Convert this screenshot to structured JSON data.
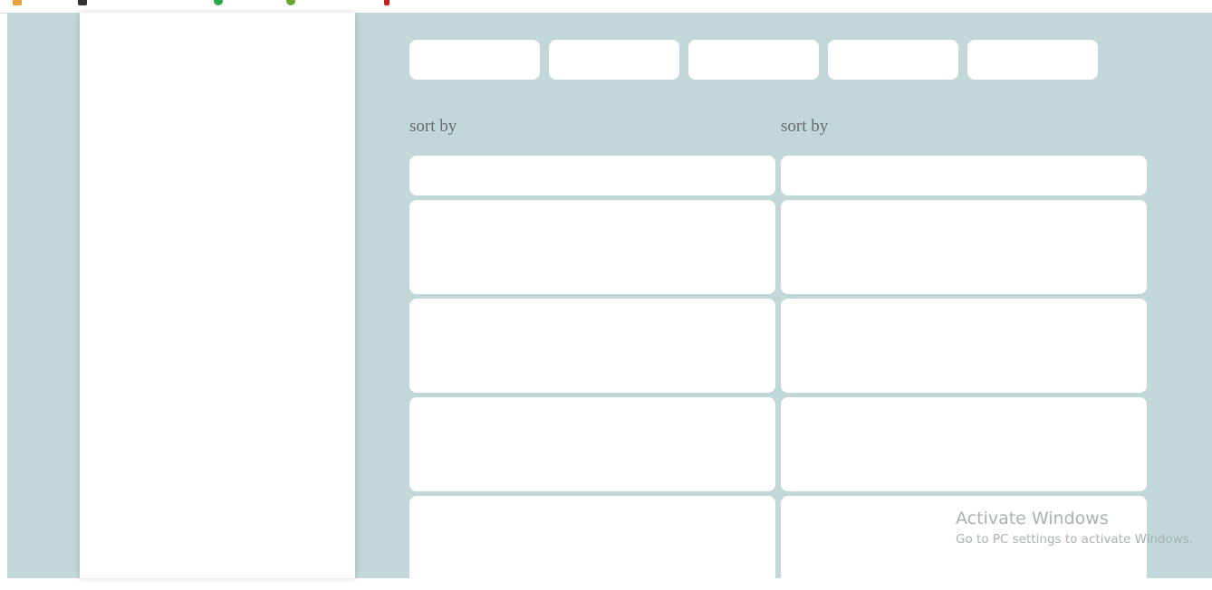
{
  "sort": {
    "left_label": "sort by",
    "right_label": "sort by"
  },
  "filters": [
    "",
    "",
    "",
    "",
    ""
  ],
  "watermark": {
    "title": "Activate Windows",
    "subtitle": "Go to PC settings to activate Windows."
  },
  "colors": {
    "page_background": "#c2d7d7",
    "panel": "#ffffff",
    "label_text": "#6b6b6b"
  }
}
